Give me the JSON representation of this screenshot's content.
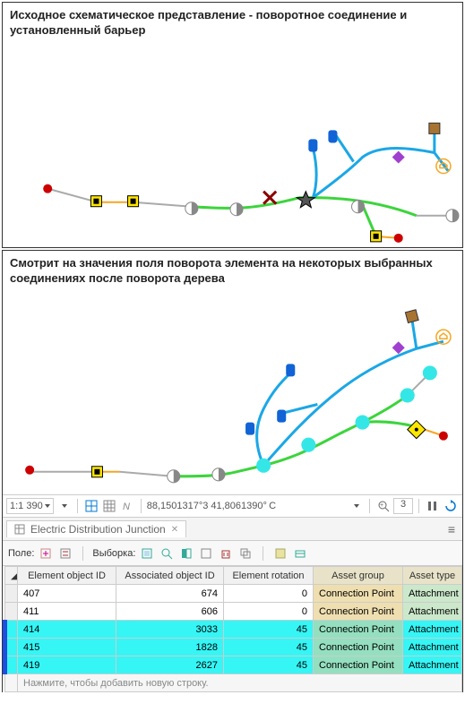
{
  "panel1": {
    "title": "Исходное схематическое представление - поворотное соединение и установленный барьер"
  },
  "panel2": {
    "title": "Смотрит на значения поля поворота элемента на некоторых выбранных соединениях после поворота дерева"
  },
  "toolbar": {
    "scale": "1:1 390",
    "coords": "88,1501317°3  41,8061390° C",
    "zoom_value": "3"
  },
  "attribute_panel": {
    "tab_title": "Electric Distribution Junction",
    "field_label": "Поле:",
    "selection_label": "Выборка:",
    "columns": {
      "c1": "Element object ID",
      "c2": "Associated object ID",
      "c3": "Element rotation",
      "c4": "Asset group",
      "c5": "Asset type"
    },
    "rows": [
      {
        "sel": false,
        "eid": "407",
        "aid": "674",
        "rot": "0",
        "grp": "Connection Point",
        "typ": "Attachment"
      },
      {
        "sel": false,
        "eid": "411",
        "aid": "606",
        "rot": "0",
        "grp": "Connection Point",
        "typ": "Attachment"
      },
      {
        "sel": true,
        "eid": "414",
        "aid": "3033",
        "rot": "45",
        "grp": "Connection Point",
        "typ": "Attachment"
      },
      {
        "sel": true,
        "eid": "415",
        "aid": "1828",
        "rot": "45",
        "grp": "Connection Point",
        "typ": "Attachment"
      },
      {
        "sel": true,
        "eid": "419",
        "aid": "2627",
        "rot": "45",
        "grp": "Connection Point",
        "typ": "Attachment"
      }
    ],
    "new_row_hint": "Нажмите, чтобы добавить новую строку."
  }
}
